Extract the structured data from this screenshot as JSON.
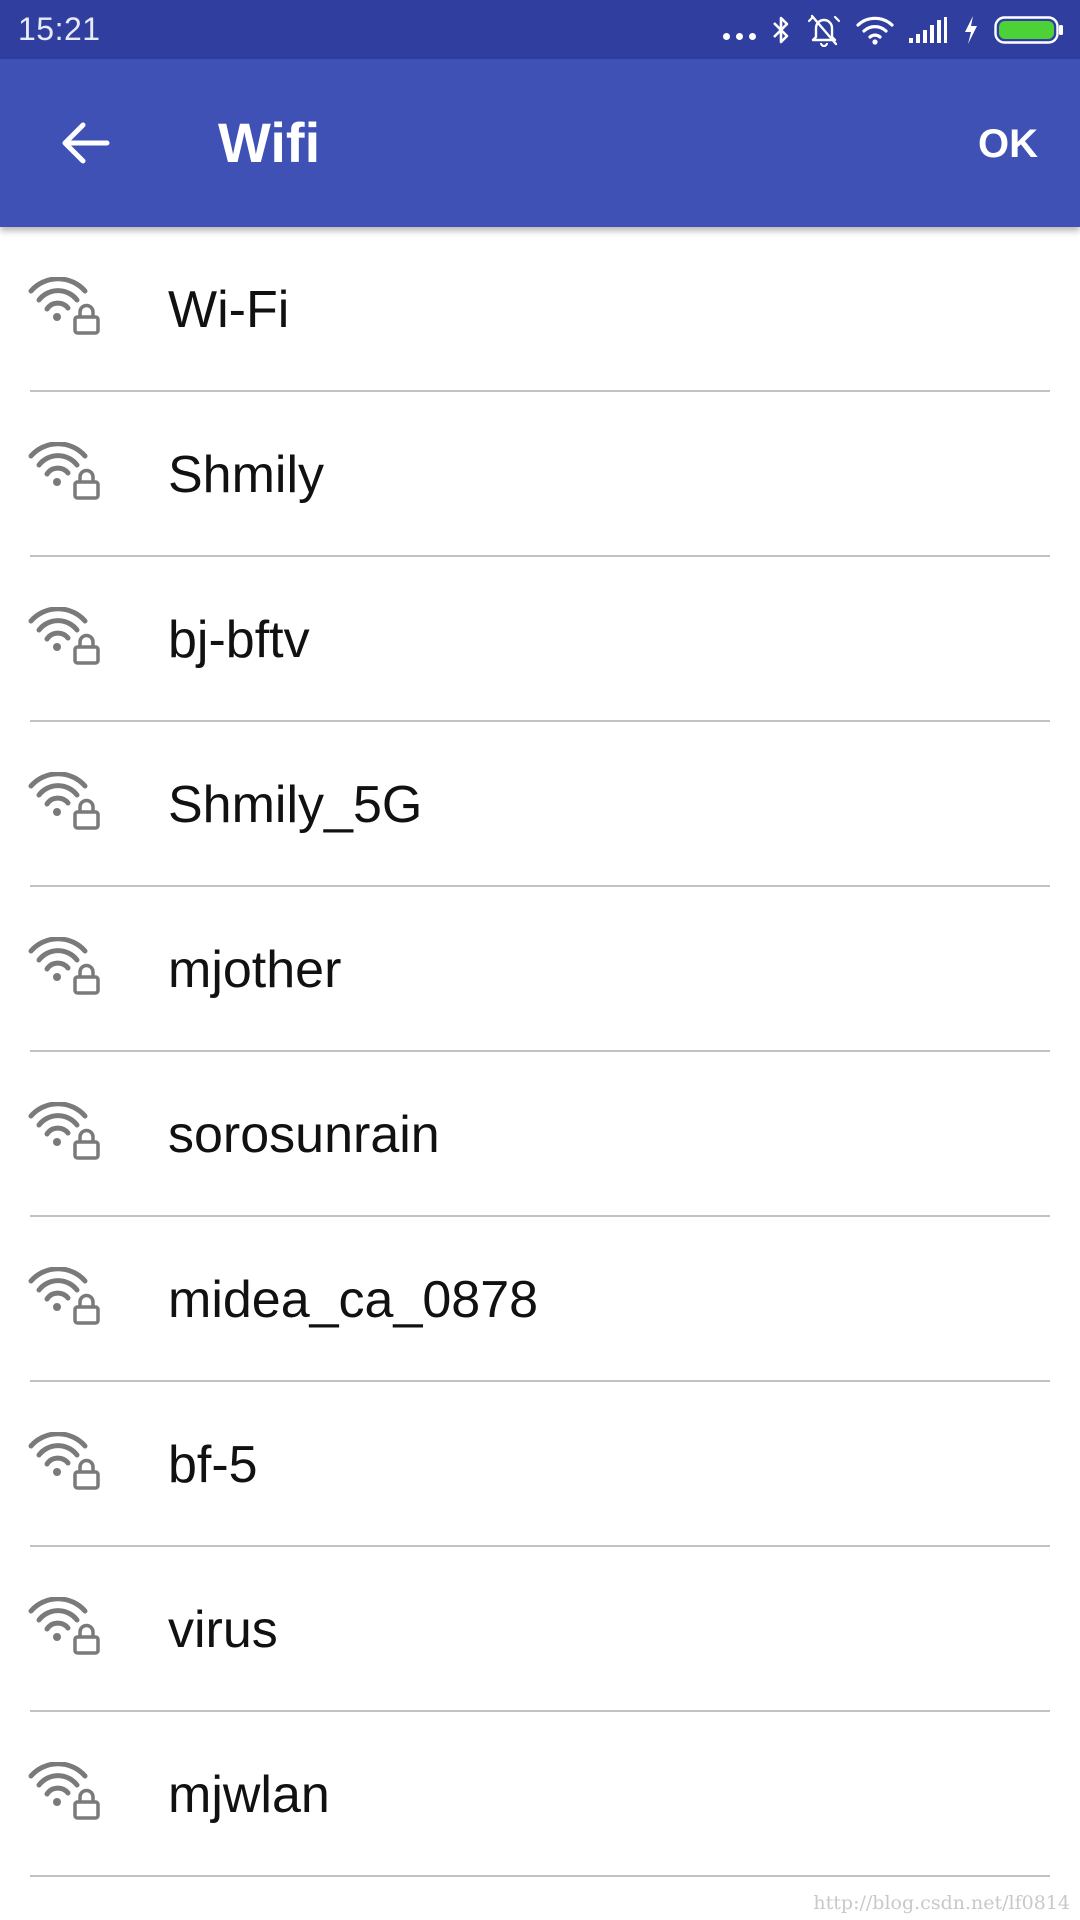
{
  "status_bar": {
    "time": "15:21",
    "icons": [
      "more-dots-icon",
      "bluetooth-icon",
      "alarm-off-icon",
      "wifi-status-icon",
      "cell-signal-icon",
      "charging-icon",
      "battery-icon"
    ],
    "battery_color": "#4cd137"
  },
  "toolbar": {
    "back_icon": "arrow-back-icon",
    "title": "Wifi",
    "ok_label": "OK",
    "color": "#3f51b5"
  },
  "wifi_networks": [
    {
      "ssid": "Wi-Fi",
      "icon": "wifi-lock-icon"
    },
    {
      "ssid": "Shmily",
      "icon": "wifi-lock-icon"
    },
    {
      "ssid": "bj-bftv",
      "icon": "wifi-lock-icon"
    },
    {
      "ssid": "Shmily_5G",
      "icon": "wifi-lock-icon"
    },
    {
      "ssid": "mjother",
      "icon": "wifi-lock-icon"
    },
    {
      "ssid": "sorosunrain",
      "icon": "wifi-lock-icon"
    },
    {
      "ssid": "midea_ca_0878",
      "icon": "wifi-lock-icon"
    },
    {
      "ssid": "bf-5",
      "icon": "wifi-lock-icon"
    },
    {
      "ssid": "virus",
      "icon": "wifi-lock-icon"
    },
    {
      "ssid": "mjwlan",
      "icon": "wifi-lock-icon"
    }
  ],
  "watermark": "http://blog.csdn.net/lf0814"
}
